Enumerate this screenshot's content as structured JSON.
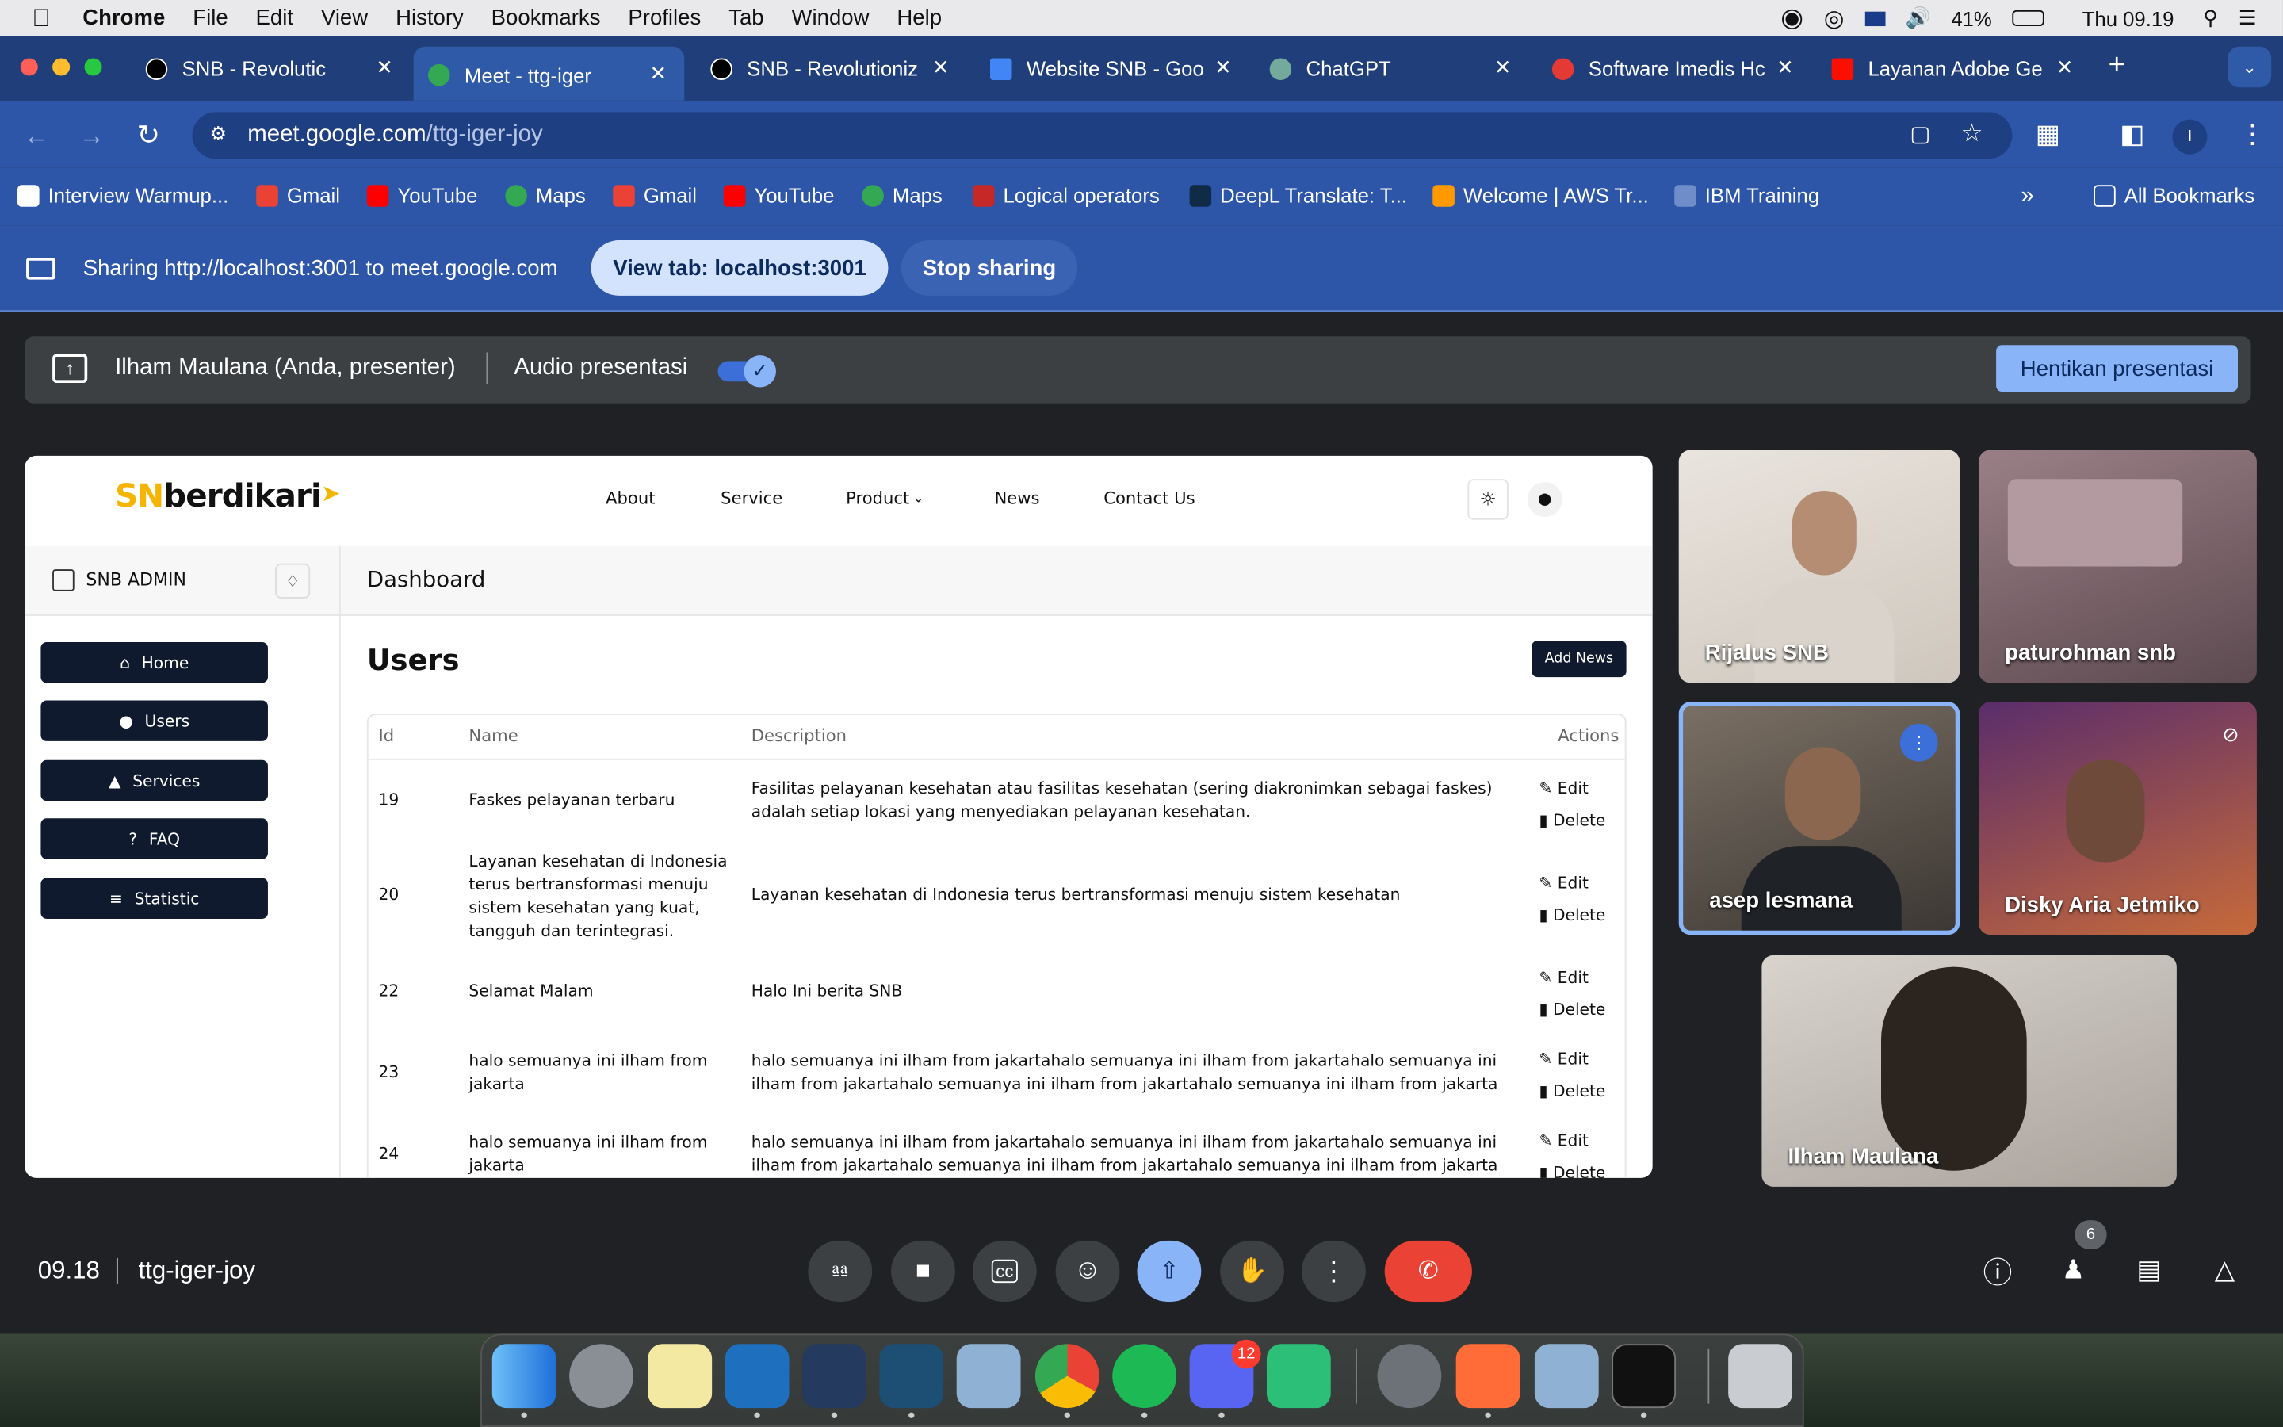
{
  "menubar": {
    "app": "Chrome",
    "items": [
      "File",
      "Edit",
      "View",
      "History",
      "Bookmarks",
      "Profiles",
      "Tab",
      "Window",
      "Help"
    ],
    "battery": "41%",
    "clock": "Thu 09.19"
  },
  "tabs": [
    {
      "title": "SNB - Revolutic"
    },
    {
      "title": "Meet - ttg-iger"
    },
    {
      "title": "SNB - Revolutioniz"
    },
    {
      "title": "Website SNB - Goo"
    },
    {
      "title": "ChatGPT"
    },
    {
      "title": "Software Imedis Hc"
    },
    {
      "title": "Layanan Adobe Ge"
    }
  ],
  "url": {
    "host": "meet.google.com",
    "path": "/ttg-iger-joy"
  },
  "bookmarks": [
    "Interview Warmup...",
    "Gmail",
    "YouTube",
    "Maps",
    "Gmail",
    "YouTube",
    "Maps",
    "Logical operators",
    "DeepL Translate: T...",
    "Welcome | AWS Tr...",
    "IBM Training"
  ],
  "bookmarks_all": "All Bookmarks",
  "sharing": {
    "text": "Sharing http://localhost:3001 to meet.google.com",
    "view_tab": "View tab: localhost:3001",
    "stop": "Stop sharing"
  },
  "presenter": {
    "name": "Ilham Maulana (Anda, presenter)",
    "audio": "Audio presentasi",
    "stop": "Hentikan presentasi"
  },
  "site": {
    "logo_sn": "SN",
    "logo_rest": "berdikari",
    "nav": [
      "About",
      "Service",
      "Product",
      "News",
      "Contact Us"
    ],
    "admin": "SNB ADMIN",
    "dashboard": "Dashboard",
    "sidebar": [
      "Home",
      "Users",
      "Services",
      "FAQ",
      "Statistic"
    ],
    "heading": "Users",
    "add_button": "Add News",
    "columns": [
      "Id",
      "Name",
      "Description",
      "Actions"
    ],
    "edit": "Edit",
    "delete": "Delete",
    "rows": [
      {
        "id": "19",
        "name": "Faskes pelayanan terbaru",
        "desc": "Fasilitas pelayanan kesehatan atau fasilitas kesehatan (sering diakronimkan sebagai faskes) adalah setiap lokasi yang menyediakan pelayanan kesehatan."
      },
      {
        "id": "20",
        "name": "Layanan kesehatan di Indonesia terus bertransformasi menuju sistem kesehatan yang kuat, tangguh dan terintegrasi.",
        "desc": "Layanan kesehatan di Indonesia terus bertransformasi menuju sistem kesehatan"
      },
      {
        "id": "22",
        "name": "Selamat Malam",
        "desc": "Halo Ini berita SNB"
      },
      {
        "id": "23",
        "name": "halo semuanya ini ilham from jakarta",
        "desc": "halo semuanya ini ilham from jakartahalo semuanya ini ilham from jakartahalo semuanya ini ilham from jakartahalo semuanya ini ilham from jakartahalo semuanya ini ilham from jakarta"
      },
      {
        "id": "24",
        "name": "halo semuanya ini ilham from jakarta",
        "desc": "halo semuanya ini ilham from jakartahalo semuanya ini ilham from jakartahalo semuanya ini ilham from jakartahalo semuanya ini ilham from jakartahalo semuanya ini ilham from jakarta"
      }
    ]
  },
  "participants": [
    "Rijalus SNB",
    "paturohman snb",
    "asep lesmana",
    "Disky Aria Jetmiko",
    "Ilham Maulana"
  ],
  "meeting": {
    "time": "09.18",
    "code": "ttg-iger-joy",
    "people_count": "6"
  },
  "dock_badge": "12"
}
